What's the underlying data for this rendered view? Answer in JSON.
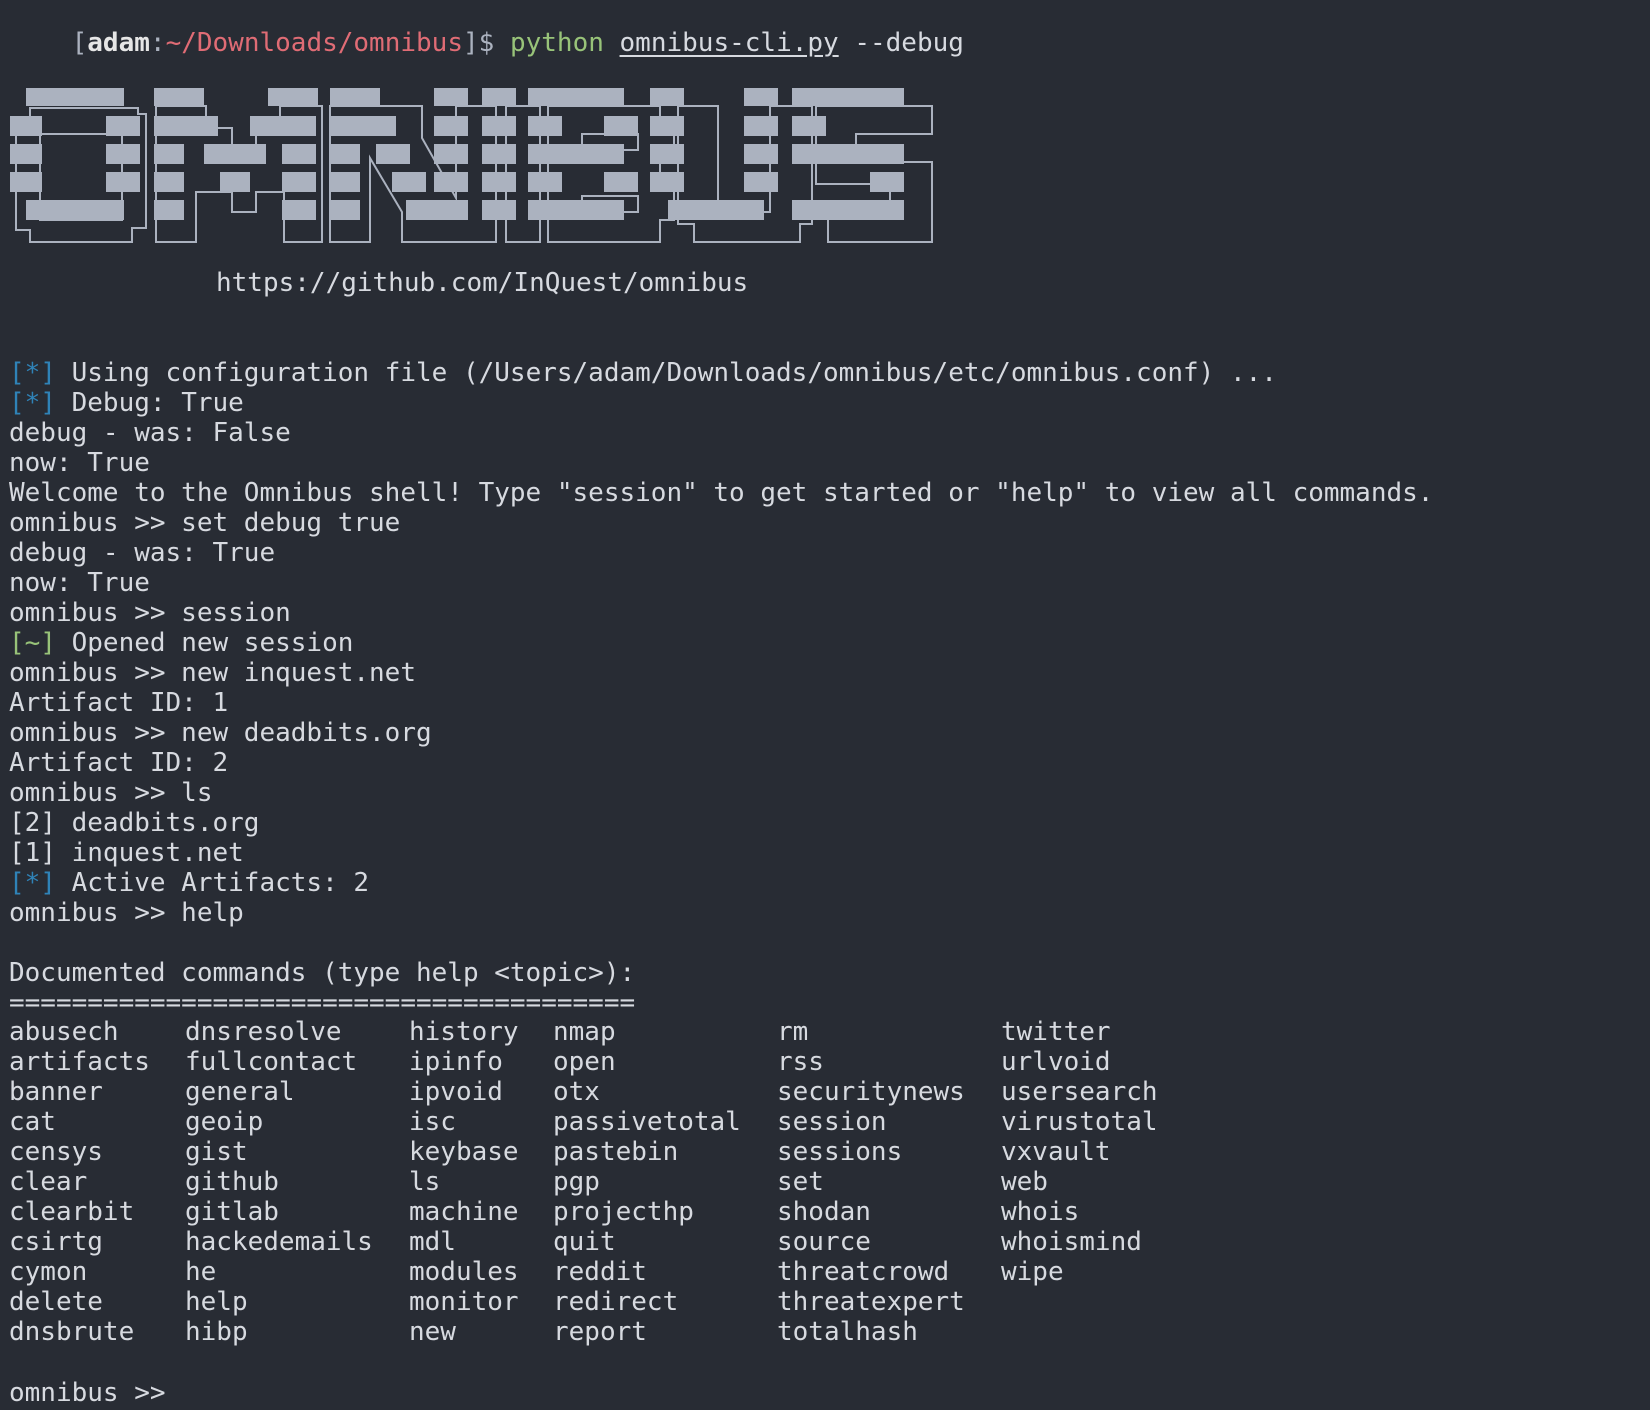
{
  "prompt_line": {
    "open_bracket": "[",
    "user": "adam",
    "colon": ":",
    "path": "~/Downloads/omnibus",
    "close": "]$",
    "command": "python",
    "script": "omnibus-cli.py",
    "flag": "--debug"
  },
  "logo": {
    "url": "https://github.com/InQuest/omnibus",
    "fill_color": "#abb2bf",
    "outline_color": "#abb2bf"
  },
  "colors": {
    "background": "#282c34",
    "text": "#d7dae0",
    "info_tag": "#2f83b8",
    "success_tag": "#98c379",
    "path": "#e06c75"
  },
  "output": {
    "l1_tag": "[*]",
    "l1_text": " Using configuration file (/Users/adam/Downloads/omnibus/etc/omnibus.conf) ...",
    "l2_tag": "[*]",
    "l2_text": " Debug: True",
    "l3": "debug - was: False",
    "l4": "now: True",
    "l5": "Welcome to the Omnibus shell! Type \"session\" to get started or \"help\" to view all commands.",
    "l6": "omnibus >> set debug true",
    "l7": "debug - was: True",
    "l8": "now: True",
    "l9": "omnibus >> session",
    "l10_tag": "[~]",
    "l10_text": " Opened new session",
    "l11": "omnibus >> new inquest.net",
    "l12": "Artifact ID: 1",
    "l13": "omnibus >> new deadbits.org",
    "l14": "Artifact ID: 2",
    "l15": "omnibus >> ls",
    "l16": "[2] deadbits.org",
    "l17": "[1] inquest.net",
    "l18_tag": "[*]",
    "l18_text": " Active Artifacts: 2",
    "l19": "omnibus >> help",
    "l20": "Documented commands (type help <topic>):",
    "l21": "========================================",
    "final_prompt": "omnibus >>"
  },
  "commands": {
    "col1": [
      "abusech",
      "artifacts",
      "banner",
      "cat",
      "censys",
      "clear",
      "clearbit",
      "csirtg",
      "cymon",
      "delete",
      "dnsbrute"
    ],
    "col2": [
      "dnsresolve",
      "fullcontact",
      "general",
      "geoip",
      "gist",
      "github",
      "gitlab",
      "hackedemails",
      "he",
      "help",
      "hibp"
    ],
    "col3": [
      "history",
      "ipinfo",
      "ipvoid",
      "isc",
      "keybase",
      "ls",
      "machine",
      "mdl",
      "modules",
      "monitor",
      "new"
    ],
    "col4": [
      "nmap",
      "open",
      "otx",
      "passivetotal",
      "pastebin",
      "pgp",
      "projecthp",
      "quit",
      "reddit",
      "redirect",
      "report"
    ],
    "col5": [
      "rm",
      "rss",
      "securitynews",
      "session",
      "sessions",
      "set",
      "shodan",
      "source",
      "threatcrowd",
      "threatexpert",
      "totalhash"
    ],
    "col6": [
      "twitter",
      "urlvoid",
      "usersearch",
      "virustotal",
      "vxvault",
      "web",
      "whois",
      "whoismind",
      "wipe"
    ]
  }
}
